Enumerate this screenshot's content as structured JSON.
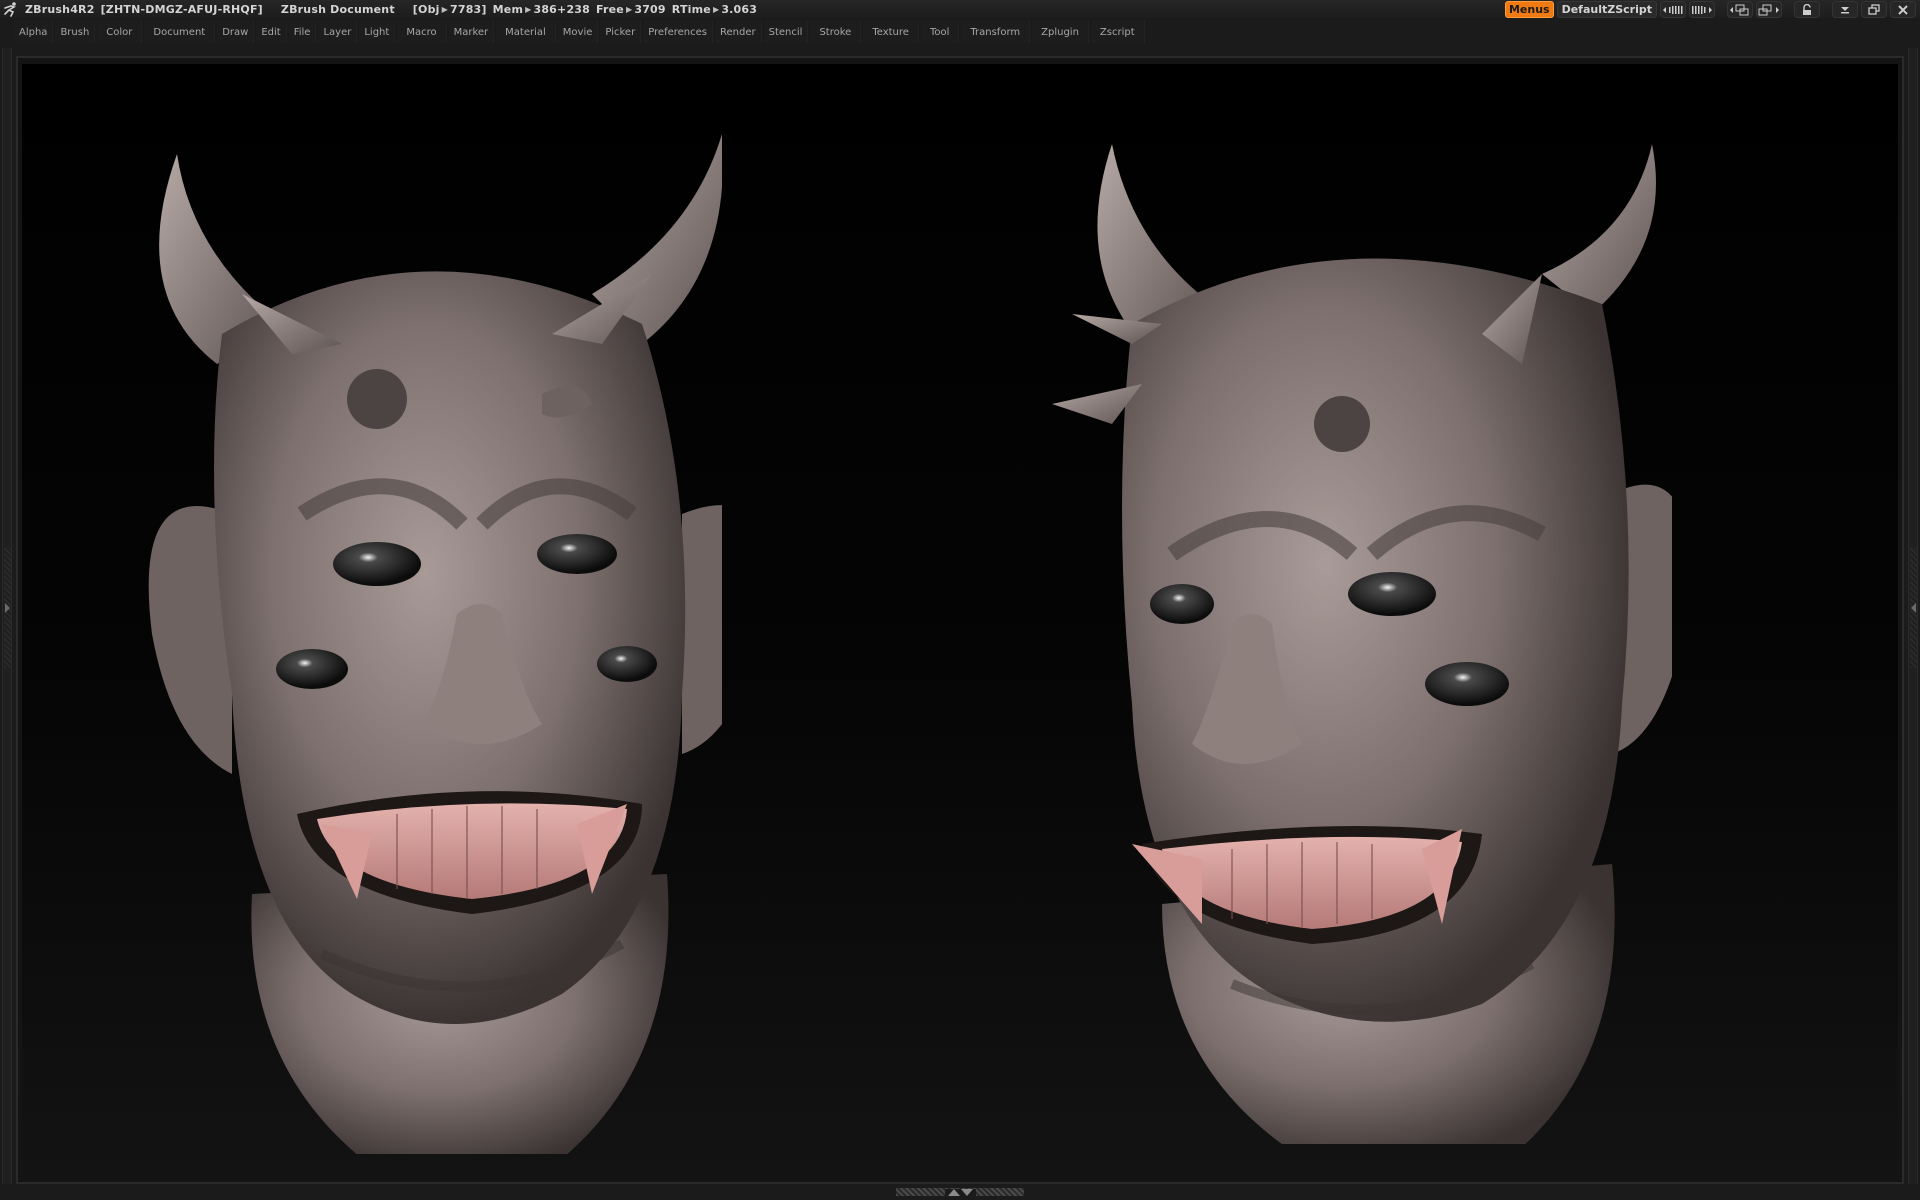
{
  "titlebar": {
    "app": "ZBrush4R2",
    "license": "[ZHTN-DMGZ-AFUJ-RHQF]",
    "document": "ZBrush Document",
    "stats": [
      {
        "label": "[Obj",
        "value": "7783]"
      },
      {
        "label": "Mem",
        "value": "386+238"
      },
      {
        "label": "Free",
        "value": "3709"
      },
      {
        "label": "RTime",
        "value": "3.063"
      }
    ],
    "menus_button": "Menus",
    "script_button": "DefaultZScript",
    "icons": {
      "logo": "zbrush-runner-logo",
      "prev_layout": "layout-prev-icon",
      "next_layout": "layout-next-icon",
      "prev_ui": "ui-prev-icon",
      "next_ui": "ui-next-icon",
      "lock": "lock-icon",
      "minimize": "minimize-icon",
      "restore": "restore-icon",
      "close": "close-icon"
    }
  },
  "menubar": {
    "items": [
      "Alpha",
      "Brush",
      "Color",
      "Document",
      "Draw",
      "Edit",
      "File",
      "Layer",
      "Light",
      "Macro",
      "Marker",
      "Material",
      "Movie",
      "Picker",
      "Preferences",
      "Render",
      "Stencil",
      "Stroke",
      "Texture",
      "Tool",
      "Transform",
      "Zplugin",
      "Zscript"
    ]
  },
  "canvas": {
    "subjects": [
      "demon-head-front-view",
      "demon-head-three-quarter-view"
    ],
    "colors": {
      "skin": "#8a7c7a",
      "skin_highlight": "#b7aaa6",
      "skin_shadow": "#3a3332",
      "teeth": "#c98b88",
      "teeth_highlight": "#e4b1ad",
      "eye": "#111111",
      "background": "#000000"
    }
  },
  "accent": {
    "menus_orange": "#f07a12"
  }
}
